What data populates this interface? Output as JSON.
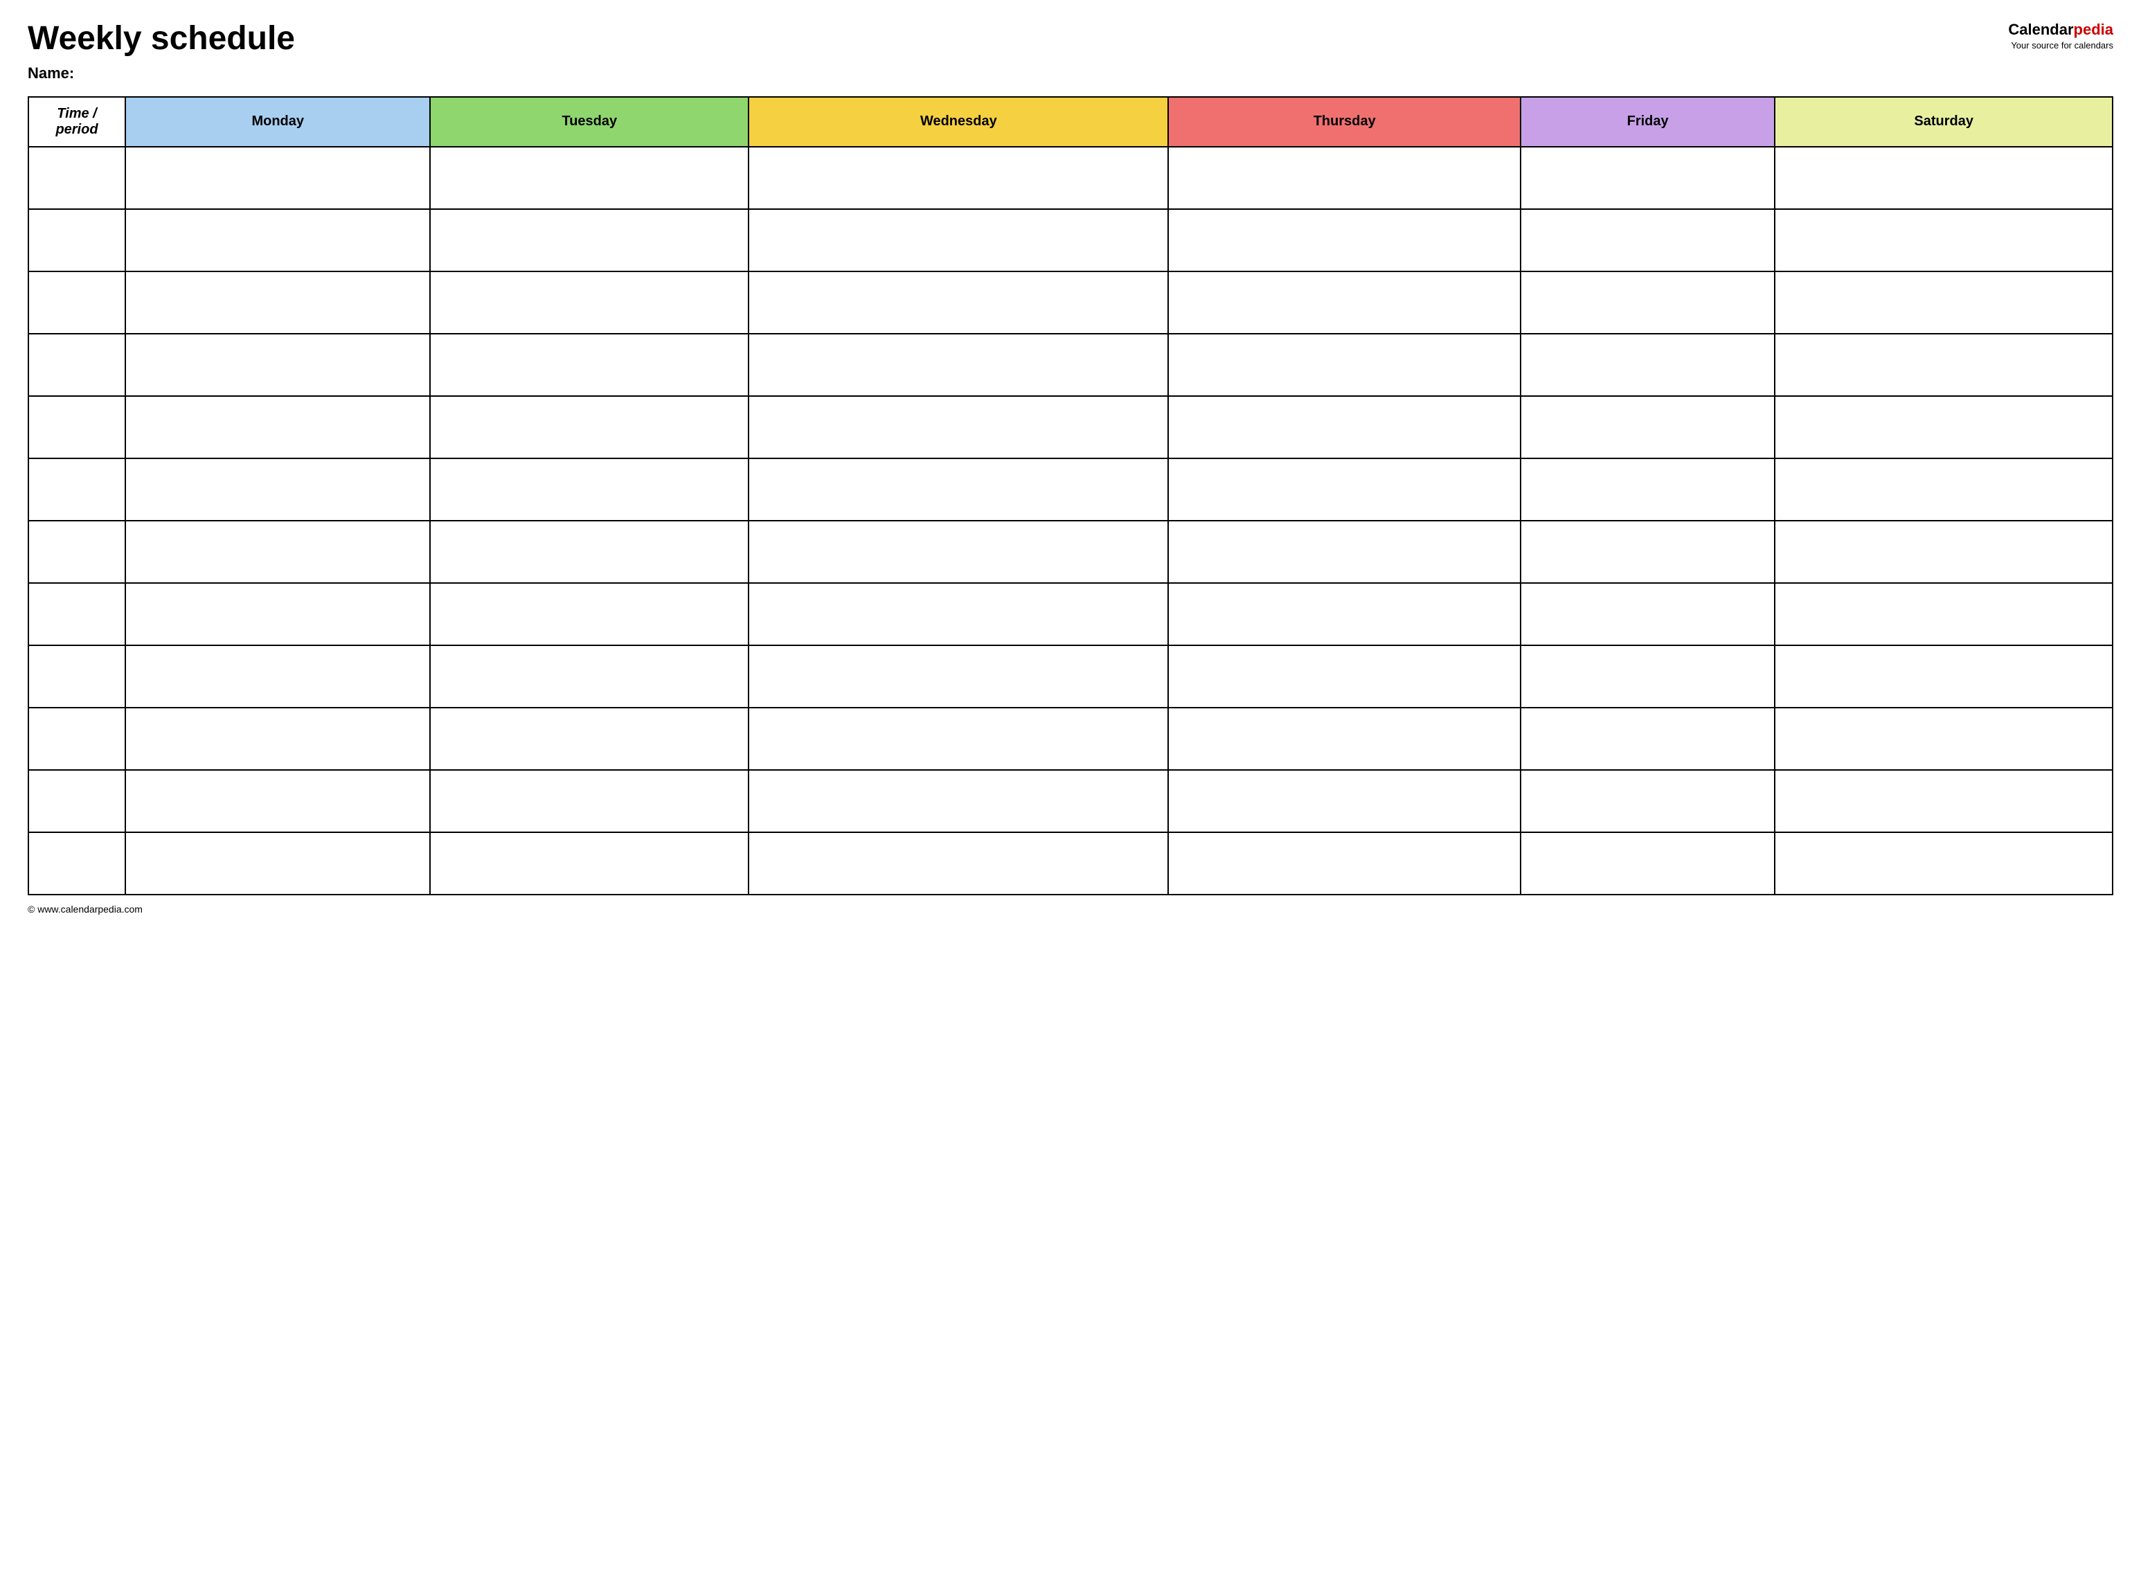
{
  "header": {
    "title": "Weekly schedule",
    "name_label": "Name:",
    "logo": {
      "calendar": "Calendar",
      "pedia": "pedia",
      "tagline": "Your source for calendars"
    }
  },
  "table": {
    "columns": [
      {
        "key": "time",
        "label": "Time / period",
        "class": "col-time"
      },
      {
        "key": "monday",
        "label": "Monday",
        "class": "col-monday"
      },
      {
        "key": "tuesday",
        "label": "Tuesday",
        "class": "col-tuesday"
      },
      {
        "key": "wednesday",
        "label": "Wednesday",
        "class": "col-wednesday"
      },
      {
        "key": "thursday",
        "label": "Thursday",
        "class": "col-thursday"
      },
      {
        "key": "friday",
        "label": "Friday",
        "class": "col-friday"
      },
      {
        "key": "saturday",
        "label": "Saturday",
        "class": "col-saturday"
      }
    ],
    "row_count": 12
  },
  "footer": {
    "url": "© www.calendarpedia.com"
  }
}
